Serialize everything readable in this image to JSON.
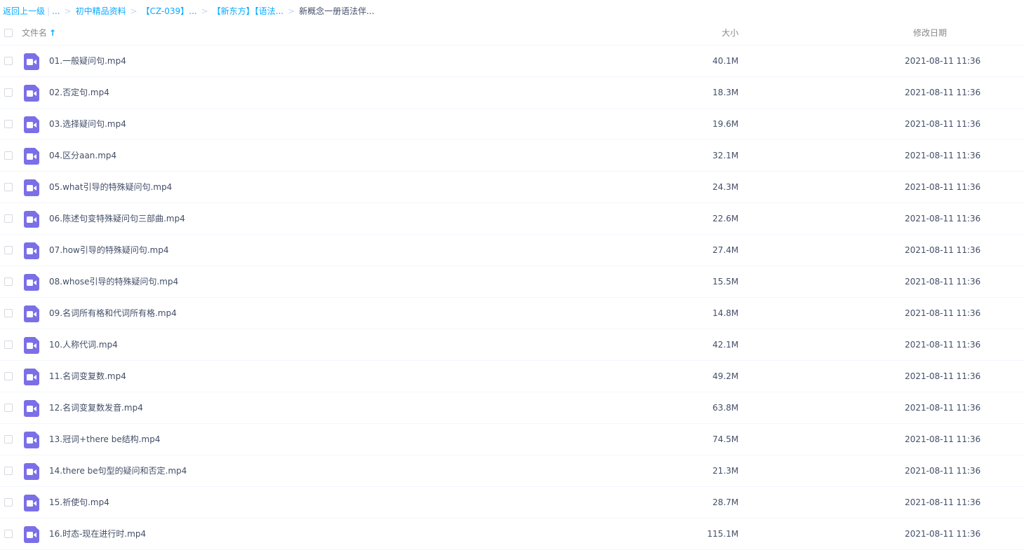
{
  "breadcrumb": {
    "back": "返回上一级",
    "pipe": "|",
    "ellipsis": "...",
    "sep": ">",
    "items": [
      "初中精品资料",
      "【CZ-039】...",
      "【新东方】【语法..."
    ],
    "current": "新概念一册语法伴..."
  },
  "header": {
    "name": "文件名",
    "sort_arrow": "↑",
    "size": "大小",
    "date": "修改日期"
  },
  "icons": {
    "file": "video-file-icon",
    "file_color": "#7b6fe8",
    "link_color": "#09aaff"
  },
  "files": [
    {
      "name": "01.一般疑问句.mp4",
      "size": "40.1M",
      "date": "2021-08-11 11:36"
    },
    {
      "name": "02.否定句.mp4",
      "size": "18.3M",
      "date": "2021-08-11 11:36"
    },
    {
      "name": "03.选择疑问句.mp4",
      "size": "19.6M",
      "date": "2021-08-11 11:36"
    },
    {
      "name": "04.区分aan.mp4",
      "size": "32.1M",
      "date": "2021-08-11 11:36"
    },
    {
      "name": "05.what引导的特殊疑问句.mp4",
      "size": "24.3M",
      "date": "2021-08-11 11:36"
    },
    {
      "name": "06.陈述句变特殊疑问句三部曲.mp4",
      "size": "22.6M",
      "date": "2021-08-11 11:36"
    },
    {
      "name": "07.how引导的特殊疑问句.mp4",
      "size": "27.4M",
      "date": "2021-08-11 11:36"
    },
    {
      "name": "08.whose引导的特殊疑问句.mp4",
      "size": "15.5M",
      "date": "2021-08-11 11:36"
    },
    {
      "name": "09.名词所有格和代词所有格.mp4",
      "size": "14.8M",
      "date": "2021-08-11 11:36"
    },
    {
      "name": "10.人称代词.mp4",
      "size": "42.1M",
      "date": "2021-08-11 11:36"
    },
    {
      "name": "11.名词变复数.mp4",
      "size": "49.2M",
      "date": "2021-08-11 11:36"
    },
    {
      "name": "12.名词变复数发音.mp4",
      "size": "63.8M",
      "date": "2021-08-11 11:36"
    },
    {
      "name": "13.冠词+there be结构.mp4",
      "size": "74.5M",
      "date": "2021-08-11 11:36"
    },
    {
      "name": "14.there be句型的疑问和否定.mp4",
      "size": "21.3M",
      "date": "2021-08-11 11:36"
    },
    {
      "name": "15.祈使句.mp4",
      "size": "28.7M",
      "date": "2021-08-11 11:36"
    },
    {
      "name": "16.时态-现在进行时.mp4",
      "size": "115.1M",
      "date": "2021-08-11 11:36"
    }
  ]
}
